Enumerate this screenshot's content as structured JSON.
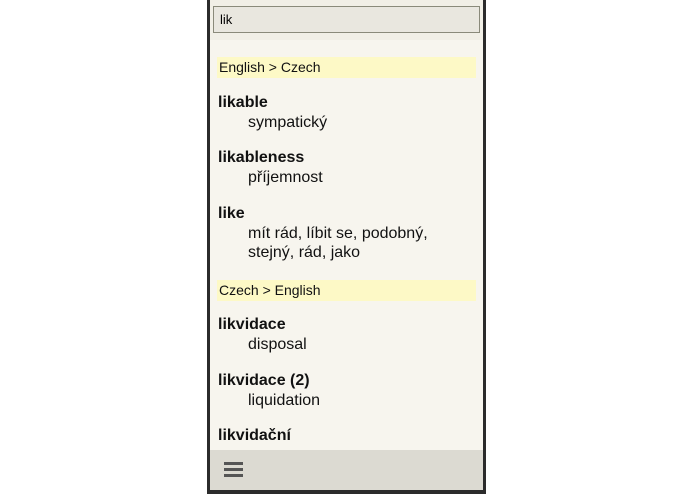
{
  "search": {
    "value": "lik"
  },
  "sections": [
    {
      "header": "English > Czech",
      "entries": [
        {
          "headword": "likable",
          "translation": [
            "sympatický"
          ]
        },
        {
          "headword": "likableness",
          "translation": [
            "příjemnost"
          ]
        },
        {
          "headword": "like",
          "translation": [
            "mít rád, líbit se, podobný,",
            "stejný, rád, jako"
          ]
        }
      ]
    },
    {
      "header": "Czech > English",
      "entries": [
        {
          "headword": "likvidace",
          "translation": [
            "disposal"
          ]
        },
        {
          "headword": "likvidace (2)",
          "translation": [
            "liquidation"
          ]
        },
        {
          "headword": "likvidační",
          "translation": []
        }
      ]
    }
  ],
  "icons": {
    "menu": "hamburger-menu-icon"
  }
}
